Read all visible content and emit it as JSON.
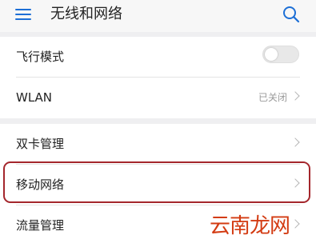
{
  "header": {
    "title": "无线和网络",
    "menu_icon": "menu-icon",
    "search_icon": "search-icon"
  },
  "colors": {
    "accent": "#1d6fd6",
    "highlight": "#a4262c",
    "watermark": "#d33b12"
  },
  "settings": {
    "airplane": {
      "label": "飞行模式",
      "toggle_on": false
    },
    "wlan": {
      "label": "WLAN",
      "status": "已关闭"
    },
    "dual_sim": {
      "label": "双卡管理"
    },
    "mobile_network": {
      "label": "移动网络"
    },
    "data_usage": {
      "label": "流量管理"
    }
  },
  "watermark": "云南龙网"
}
